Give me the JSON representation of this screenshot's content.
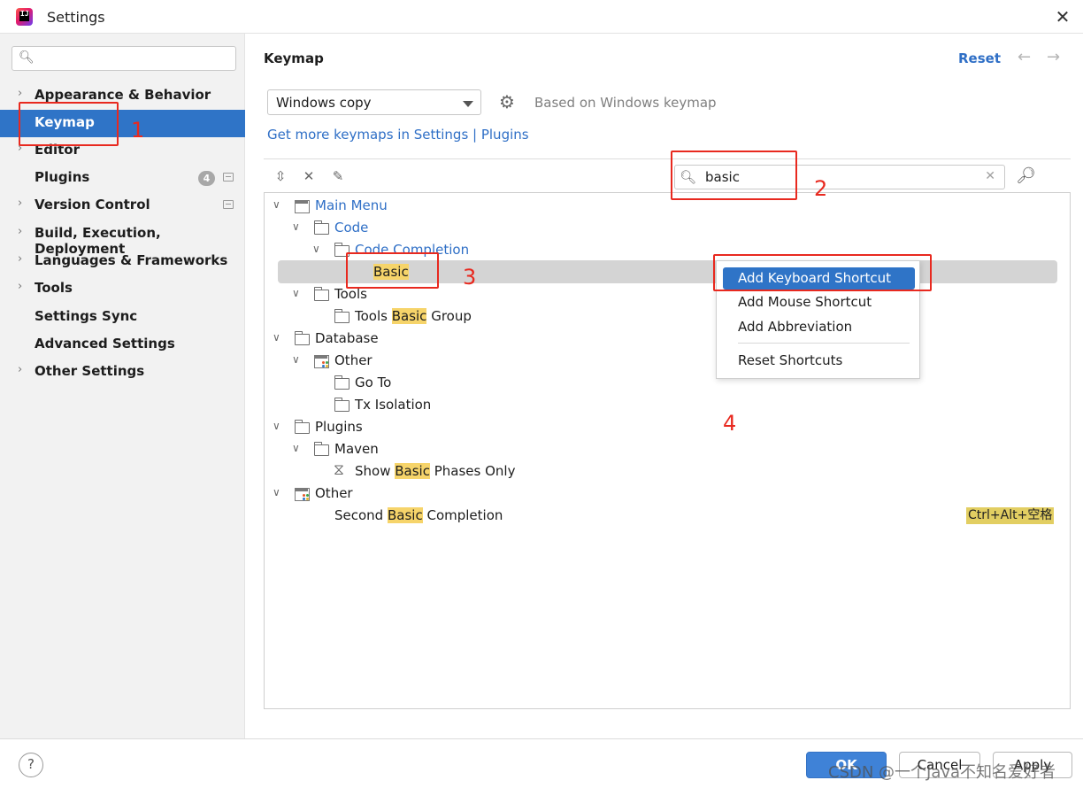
{
  "window": {
    "title": "Settings",
    "close_label": "✕"
  },
  "sidebar": {
    "items": [
      {
        "label": "Appearance & Behavior"
      },
      {
        "label": "Keymap"
      },
      {
        "label": "Editor"
      },
      {
        "label": "Plugins",
        "badge": "4"
      },
      {
        "label": "Version Control"
      },
      {
        "label": "Build, Execution, Deployment"
      },
      {
        "label": "Languages & Frameworks"
      },
      {
        "label": "Tools"
      },
      {
        "label": "Settings Sync"
      },
      {
        "label": "Advanced Settings"
      },
      {
        "label": "Other Settings"
      }
    ]
  },
  "main": {
    "title": "Keymap",
    "reset_label": "Reset",
    "keymap_select": "Windows copy",
    "based_on": "Based on Windows keymap",
    "more_keymaps": "Get more keymaps in Settings | Plugins",
    "search_value": "basic"
  },
  "tree": {
    "main_menu": "Main Menu",
    "code": "Code",
    "code_completion": "Code Completion",
    "basic": "Basic",
    "tools": "Tools",
    "tools_basic_group": {
      "pre": "Tools ",
      "hl": "Basic",
      "post": " Group"
    },
    "database": "Database",
    "other1": "Other",
    "go_to": "Go To",
    "tx_isolation": "Tx Isolation",
    "plugins": "Plugins",
    "maven": "Maven",
    "show_basic": {
      "pre": "Show ",
      "hl": "Basic",
      "post": " Phases Only"
    },
    "other2": "Other",
    "second_basic": {
      "pre": "Second ",
      "hl": "Basic",
      "post": " Completion"
    },
    "second_basic_shortcut": "Ctrl+Alt+空格"
  },
  "context_menu": {
    "items": [
      "Add Keyboard Shortcut",
      "Add Mouse Shortcut",
      "Add Abbreviation",
      "Reset Shortcuts"
    ]
  },
  "annotations": [
    "1",
    "2",
    "3",
    "4"
  ],
  "buttons": {
    "ok": "OK",
    "cancel": "Cancel",
    "apply": "Apply",
    "help": "?"
  },
  "watermark": "CSDN @一个Java不知名爱好者",
  "colors": {
    "accent": "#2f74c7",
    "link": "#2f6fc6",
    "highlight": "#f6d46a",
    "annotation": "#e8291f"
  }
}
